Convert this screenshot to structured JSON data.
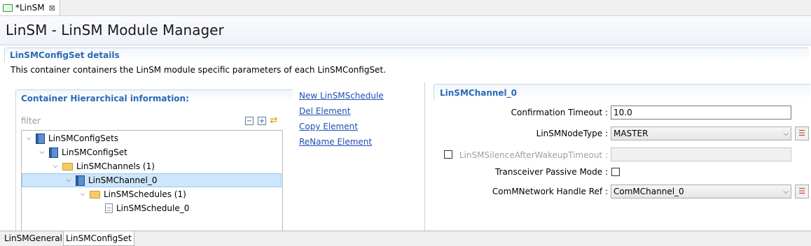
{
  "editor_tab": {
    "label": "*LinSM",
    "close": "⊠"
  },
  "page": {
    "title": "LinSM - LinSM Module Manager"
  },
  "section": {
    "title": "LinSMConfigSet details",
    "description": "This container containers the LinSM module specific parameters of each LinSMConfigSet."
  },
  "hierarchy": {
    "title": "Container Hierarchical information:",
    "filter_placeholder": "filter",
    "toolbar": {
      "collapse": "−",
      "expand": "+",
      "sync": "⇄"
    },
    "tree": [
      {
        "label": "LinSMConfigSets",
        "icon": "module-icon",
        "expanded": true
      },
      {
        "label": "LinSMConfigSet",
        "icon": "module-icon",
        "expanded": true
      },
      {
        "label": "LinSMChannels (1)",
        "icon": "folder-icon",
        "expanded": true
      },
      {
        "label": "LinSMChannel_0",
        "icon": "module-icon",
        "expanded": true,
        "selected": true
      },
      {
        "label": "LinSMSchedules (1)",
        "icon": "folder-icon",
        "expanded": true
      },
      {
        "label": "LinSMSchedule_0",
        "icon": "document-icon"
      }
    ]
  },
  "actions": [
    "New LinSMSchedule",
    "Del Element",
    "Copy Element",
    "ReName Element"
  ],
  "details": {
    "title": "LinSMChannel_0",
    "confirmation_timeout": {
      "label": "Confirmation Timeout :",
      "value": "10.0"
    },
    "node_type": {
      "label": "LinSMNodeType :",
      "value": "MASTER"
    },
    "silence_after_wakeup": {
      "label": "LinSMSilenceAfterWakeupTimeout :",
      "value": "",
      "enabled": false
    },
    "transceiver_passive": {
      "label": "Transceiver Passive Mode :",
      "checked": false
    },
    "comm_network": {
      "label": "ComMNetwork Handle Ref :",
      "value": "ComMChannel_0"
    }
  },
  "bottom_tabs": [
    "LinSMGeneral",
    "LinSMConfigSet"
  ],
  "colors": {
    "accent": "#2a6ab3",
    "link": "#1f4fb3",
    "selection": "#cde6fb"
  }
}
